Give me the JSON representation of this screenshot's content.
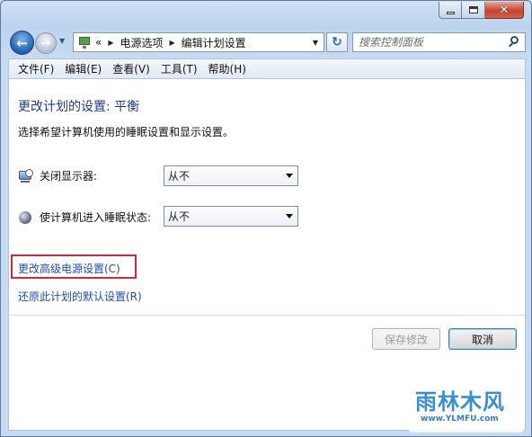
{
  "window": {
    "caption_buttons": {
      "minimize": "minimize",
      "maximize": "maximize",
      "close": "close"
    }
  },
  "nav": {
    "address": {
      "chevron": "«",
      "crumbs": [
        "电源选项",
        "编辑计划设置"
      ]
    },
    "search": {
      "placeholder": "搜索控制面板"
    }
  },
  "menu": [
    "文件(F)",
    "编辑(E)",
    "查看(V)",
    "工具(T)",
    "帮助(H)"
  ],
  "content": {
    "title": "更改计划的设置: 平衡",
    "description": "选择希望计算机使用的睡眠设置和显示设置。",
    "settings": [
      {
        "label": "关闭显示器:",
        "value": "从不",
        "icon": "display-off-icon"
      },
      {
        "label": "使计算机进入睡眠状态:",
        "value": "从不",
        "icon": "sleep-moon-icon"
      }
    ],
    "links": {
      "advanced": "更改高级电源设置(C)",
      "restore": "还原此计划的默认设置(R)"
    },
    "buttons": {
      "save": "保存修改",
      "cancel": "取消"
    }
  },
  "watermark": {
    "text": "雨林木风",
    "url": "www.YLMFU.com"
  },
  "colors": {
    "title_blue": "#1e3a87",
    "link_blue": "#1e4db2",
    "highlight_red": "#d9263b"
  }
}
